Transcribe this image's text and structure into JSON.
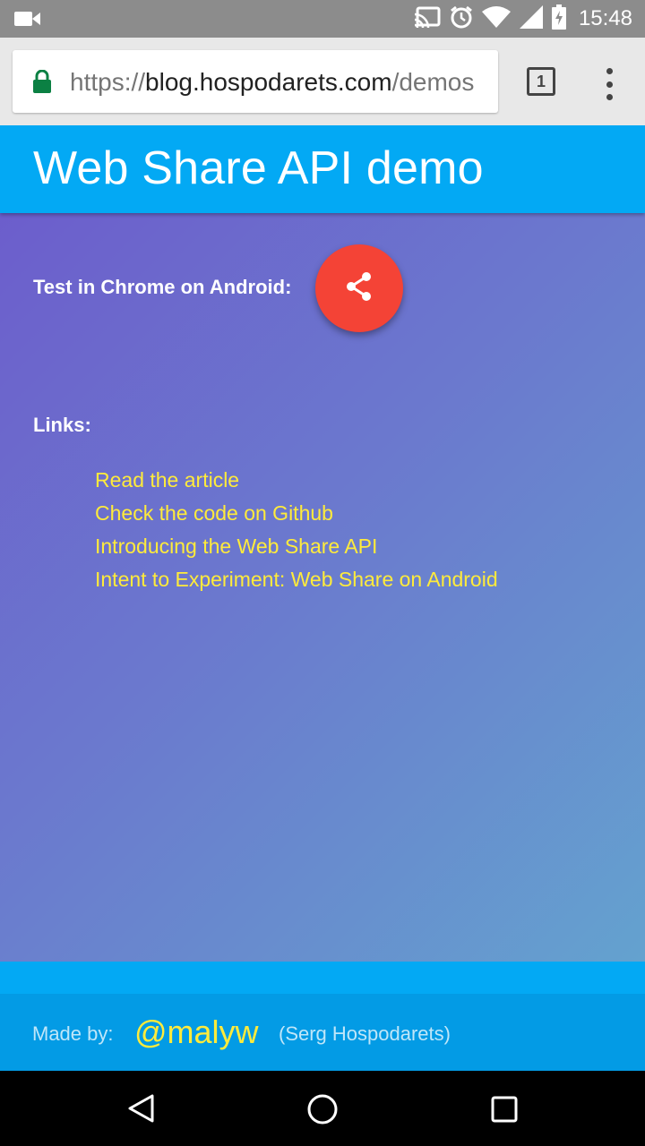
{
  "status_bar": {
    "time": "15:48",
    "icons": [
      "video-camera-icon",
      "cast-icon",
      "alarm-icon",
      "wifi-icon",
      "signal-icon",
      "battery-charging-icon"
    ]
  },
  "browser": {
    "url_scheme": "https://",
    "url_host": "blog.hospodarets.com",
    "url_path": "/demos",
    "tab_count": "1",
    "icons": [
      "lock-icon",
      "tabs-icon",
      "menu-dots-icon"
    ]
  },
  "page": {
    "title": "Web Share API demo",
    "test_label": "Test in Chrome on Android:",
    "links_label": "Links:",
    "links": [
      "Read the article",
      "Check the code on Github",
      "Introducing the Web Share API",
      "Intent to Experiment: Web Share on Android"
    ],
    "share_icon": "share-icon"
  },
  "footer": {
    "made_by": "Made by:",
    "handle": "@malyw",
    "full_name": "(Serg Hospodarets)"
  },
  "nav": {
    "icons": [
      "back-icon",
      "home-icon",
      "recent-apps-icon"
    ]
  },
  "colors": {
    "header": "#03a9f4",
    "fab": "#f44336",
    "link": "#ffeb3b",
    "footer": "#039be5"
  }
}
